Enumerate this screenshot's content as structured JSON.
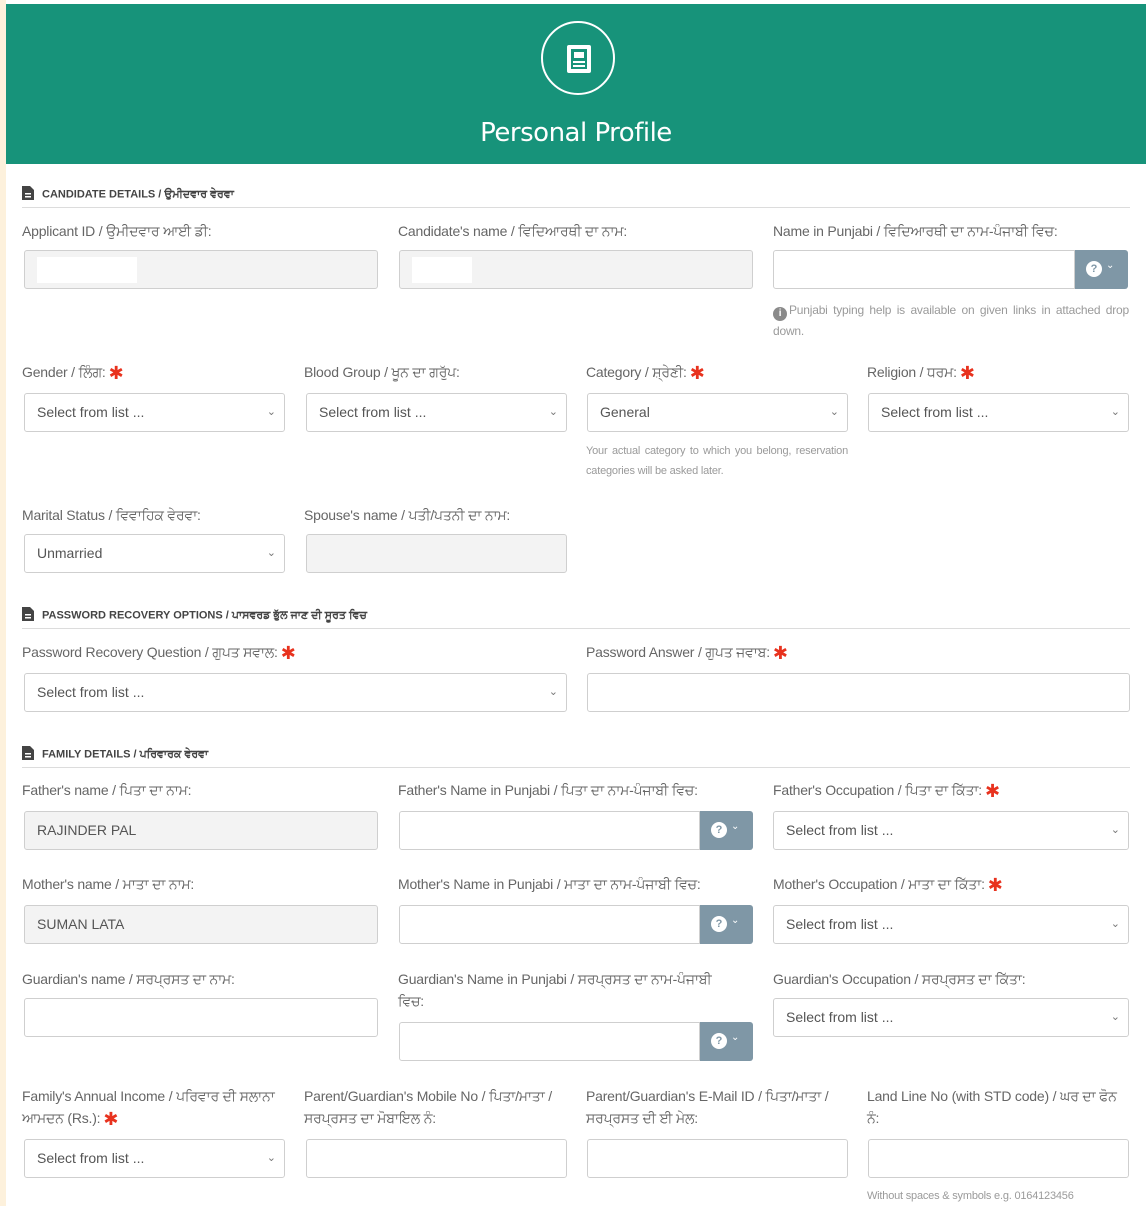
{
  "header": {
    "title": "Personal Profile",
    "icon": "id-card-icon"
  },
  "sections": {
    "candidate": "CANDIDATE DETAILS / ਉਮੀਦਵਾਰ ਵੇਰਵਾ",
    "password": "PASSWORD RECOVERY OPTIONS / ਪਾਸਵਰਡ ਭੁੱਲ ਜਾਣ ਦੀ ਸੂਰਤ ਵਿਚ",
    "family": "FAMILY DETAILS / ਪਰਿਵਾਰਕ ਵੇਰਵਾ"
  },
  "candidate": {
    "applicant_id_label": "Applicant ID / ਉਮੀਦਵਾਰ ਆਈ ਡੀ:",
    "candidate_name_label": "Candidate's name / ਵਿਦਿਆਰਥੀ ਦਾ ਨਾਮ:",
    "name_punjabi_label": "Name in Punjabi / ਵਿਦਿਆਰਥੀ ਦਾ ਨਾਮ-ਪੰਜਾਬੀ ਵਿਚ:",
    "punjabi_help": "Punjabi typing help is available on given links in attached drop down.",
    "gender_label": "Gender / ਲਿੰਗ:",
    "gender_value": "Select from list ...",
    "blood_group_label": "Blood Group / ਖੂਨ ਦਾ ਗਰੁੱਪ:",
    "blood_group_value": "Select from list ...",
    "category_label": "Category / ਸ਼੍ਰੇਣੀ:",
    "category_value": "General",
    "category_help": "Your actual category to which you belong, reservation categories will be asked later.",
    "religion_label": "Religion / ਧਰਮ:",
    "religion_value": "Select from list ...",
    "marital_label": "Marital Status / ਵਿਵਾਹਿਕ ਵੇਰਵਾ:",
    "marital_value": "Unmarried",
    "spouse_label": "Spouse's name / ਪਤੀ/ਪਤਨੀ ਦਾ ਨਾਮ:"
  },
  "password": {
    "question_label": "Password Recovery Question / ਗੁਪਤ ਸਵਾਲ:",
    "question_value": "Select from list ...",
    "answer_label": "Password Answer / ਗੁਪਤ ਜਵਾਬ:"
  },
  "family": {
    "father_name_label": "Father's name / ਪਿਤਾ ਦਾ ਨਾਮ:",
    "father_name_value": "RAJINDER PAL",
    "father_punjabi_label": "Father's Name in Punjabi / ਪਿਤਾ ਦਾ ਨਾਮ-ਪੰਜਾਬੀ ਵਿਚ:",
    "father_occ_label": "Father's Occupation / ਪਿਤਾ ਦਾ ਕਿੱਤਾ:",
    "father_occ_value": "Select from list ...",
    "mother_name_label": "Mother's name / ਮਾਤਾ ਦਾ ਨਾਮ:",
    "mother_name_value": "SUMAN LATA",
    "mother_punjabi_label": "Mother's Name in Punjabi / ਮਾਤਾ ਦਾ ਨਾਮ-ਪੰਜਾਬੀ ਵਿਚ:",
    "mother_occ_label": "Mother's Occupation / ਮਾਤਾ ਦਾ ਕਿੱਤਾ:",
    "mother_occ_value": "Select from list ...",
    "guardian_name_label": "Guardian's name / ਸਰਪ੍ਰਸਤ ਦਾ ਨਾਮ:",
    "guardian_punjabi_label": "Guardian's Name in Punjabi / ਸਰਪ੍ਰਸਤ ਦਾ ਨਾਮ-ਪੰਜਾਬੀ ਵਿਚ:",
    "guardian_occ_label": "Guardian's Occupation / ਸਰਪ੍ਰਸਤ ਦਾ ਕਿੱਤਾ:",
    "guardian_occ_value": "Select from list ...",
    "income_label": "Family's Annual Income / ਪਰਿਵਾਰ ਦੀ ਸਲਾਨਾ ਆਮਦਨ (Rs.):",
    "income_value": "Select from list ...",
    "mobile_label": "Parent/Guardian's Mobile No / ਪਿਤਾ/ਮਾਤਾ /ਸਰਪ੍ਰਸਤ ਦਾ ਮੋਬਾਇਲ ਨੰ:",
    "email_label": "Parent/Guardian's E-Mail ID / ਪਿਤਾ/ਮਾਤਾ /ਸਰਪ੍ਰਸਤ ਦੀ ਈ ਮੇਲ:",
    "landline_label": "Land Line No (with STD code) / ਘਰ ਦਾ ਫੋਨ ਨੰ:",
    "landline_help": "Without spaces & symbols e.g. 0164123456"
  },
  "required_mark": "✱",
  "addon_help_glyph": "?",
  "caret_glyph": "⌄",
  "colors": {
    "header_bg": "#17937a",
    "required": "#e8321e",
    "addon_bg": "#7f97a6"
  }
}
